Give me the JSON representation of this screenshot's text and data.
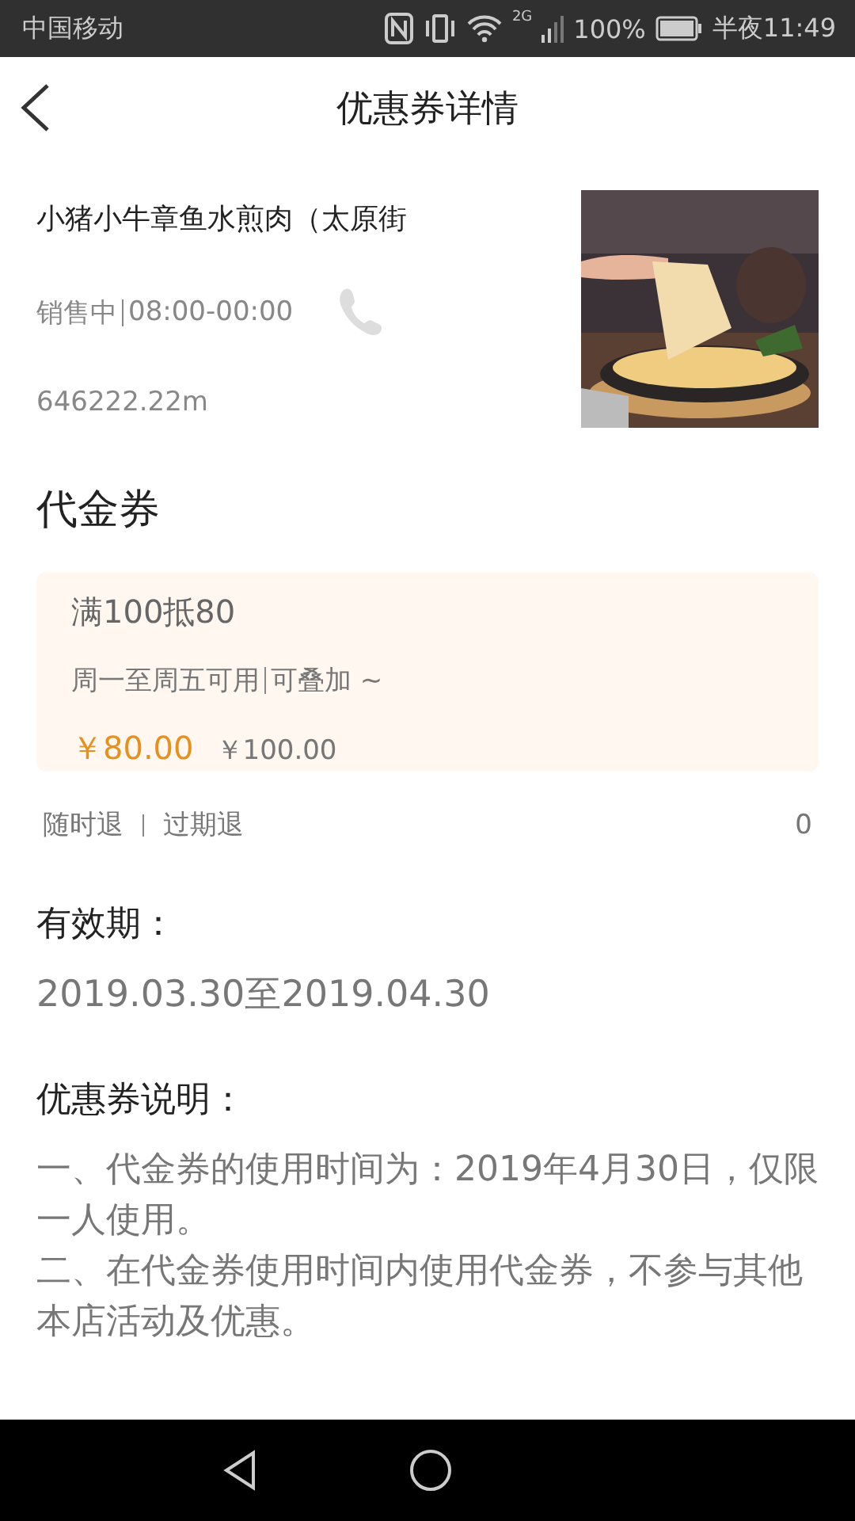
{
  "status_bar": {
    "carrier": "中国移动",
    "battery": "100%",
    "network": "2G",
    "time": "半夜11:49"
  },
  "header": {
    "title": "优惠券详情"
  },
  "shop": {
    "name": "小猪小牛章鱼水煎肉（太原街",
    "status": "销售中",
    "hours": "08:00-00:00",
    "distance": "646222.22m"
  },
  "coupon_section": {
    "title": "代金券"
  },
  "coupon": {
    "title": "满100抵80",
    "terms": "周一至周五可用",
    "stackable": "可叠加 ~",
    "price": "￥80.00",
    "original_price": "￥100.00"
  },
  "refund": {
    "options": [
      "随时退",
      "过期退"
    ],
    "sold": "0"
  },
  "validity": {
    "title": "有效期：",
    "range": "2019.03.30至2019.04.30"
  },
  "description": {
    "title": "优惠券说明：",
    "paragraphs": [
      "一、代金券的使用时间为：2019年4月30日，仅限一人使用。",
      "二、在代金券使用时间内使用代金券，不参与其他本店活动及优惠。"
    ]
  }
}
